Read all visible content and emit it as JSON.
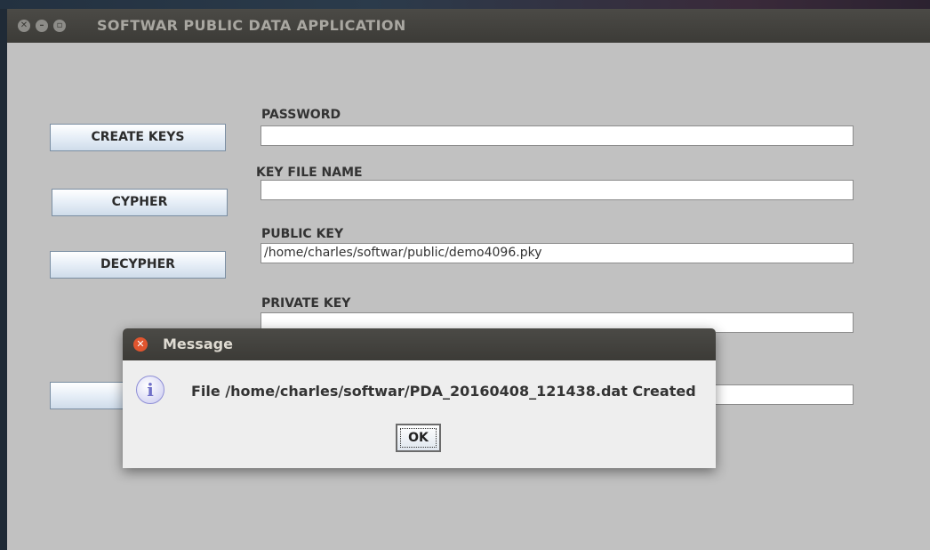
{
  "window": {
    "title": "SOFTWAR PUBLIC DATA APPLICATION"
  },
  "buttons": {
    "create_keys": "CREATE KEYS",
    "cypher": "CYPHER",
    "decypher": "DECYPHER",
    "fifth": ""
  },
  "fields": {
    "password_label": "PASSWORD",
    "password_value": "",
    "key_file_name_label": "KEY FILE NAME",
    "key_file_name_value": "",
    "public_key_label": "PUBLIC KEY",
    "public_key_value": "/home/charles/softwar/public/demo4096.pky",
    "private_key_label": "PRIVATE KEY",
    "private_key_value": "",
    "fifth_value": ""
  },
  "dialog": {
    "title": "Message",
    "icon": "info-icon",
    "message": "File /home/charles/softwar/PDA_20160408_121438.dat Created",
    "ok_label": "OK"
  },
  "colors": {
    "window_bg": "#c1c1c1",
    "titlebar": "#3c3b37",
    "close_button": "#e0552f"
  }
}
